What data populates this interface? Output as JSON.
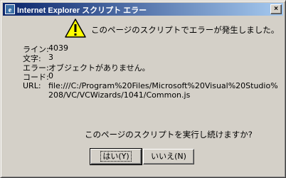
{
  "window": {
    "title": "Internet Explorer スクリプト エラー",
    "close_glyph": "×"
  },
  "dialog": {
    "message": "このページのスクリプトでエラーが発生しました。",
    "details": [
      {
        "label": "ライン:",
        "value": "4039"
      },
      {
        "label": "文字:",
        "value": "3"
      },
      {
        "label": "エラー:",
        "value": "オブジェクトがありません。"
      },
      {
        "label": "コード:",
        "value": "0"
      },
      {
        "label": "URL:",
        "value": "file:///C:/Program%20Files/Microsoft%20Visual%20Studio%"
      }
    ],
    "url_line2": "208/VC/VCWizards/1041/Common.js",
    "question": "このページのスクリプトを実行し続けますか?",
    "yes_label": "はい(Y)",
    "no_label": "いいえ(N)"
  },
  "icons": {
    "title": "ie-icon",
    "warning": "warning-icon",
    "warning_color": "#ffff00"
  }
}
